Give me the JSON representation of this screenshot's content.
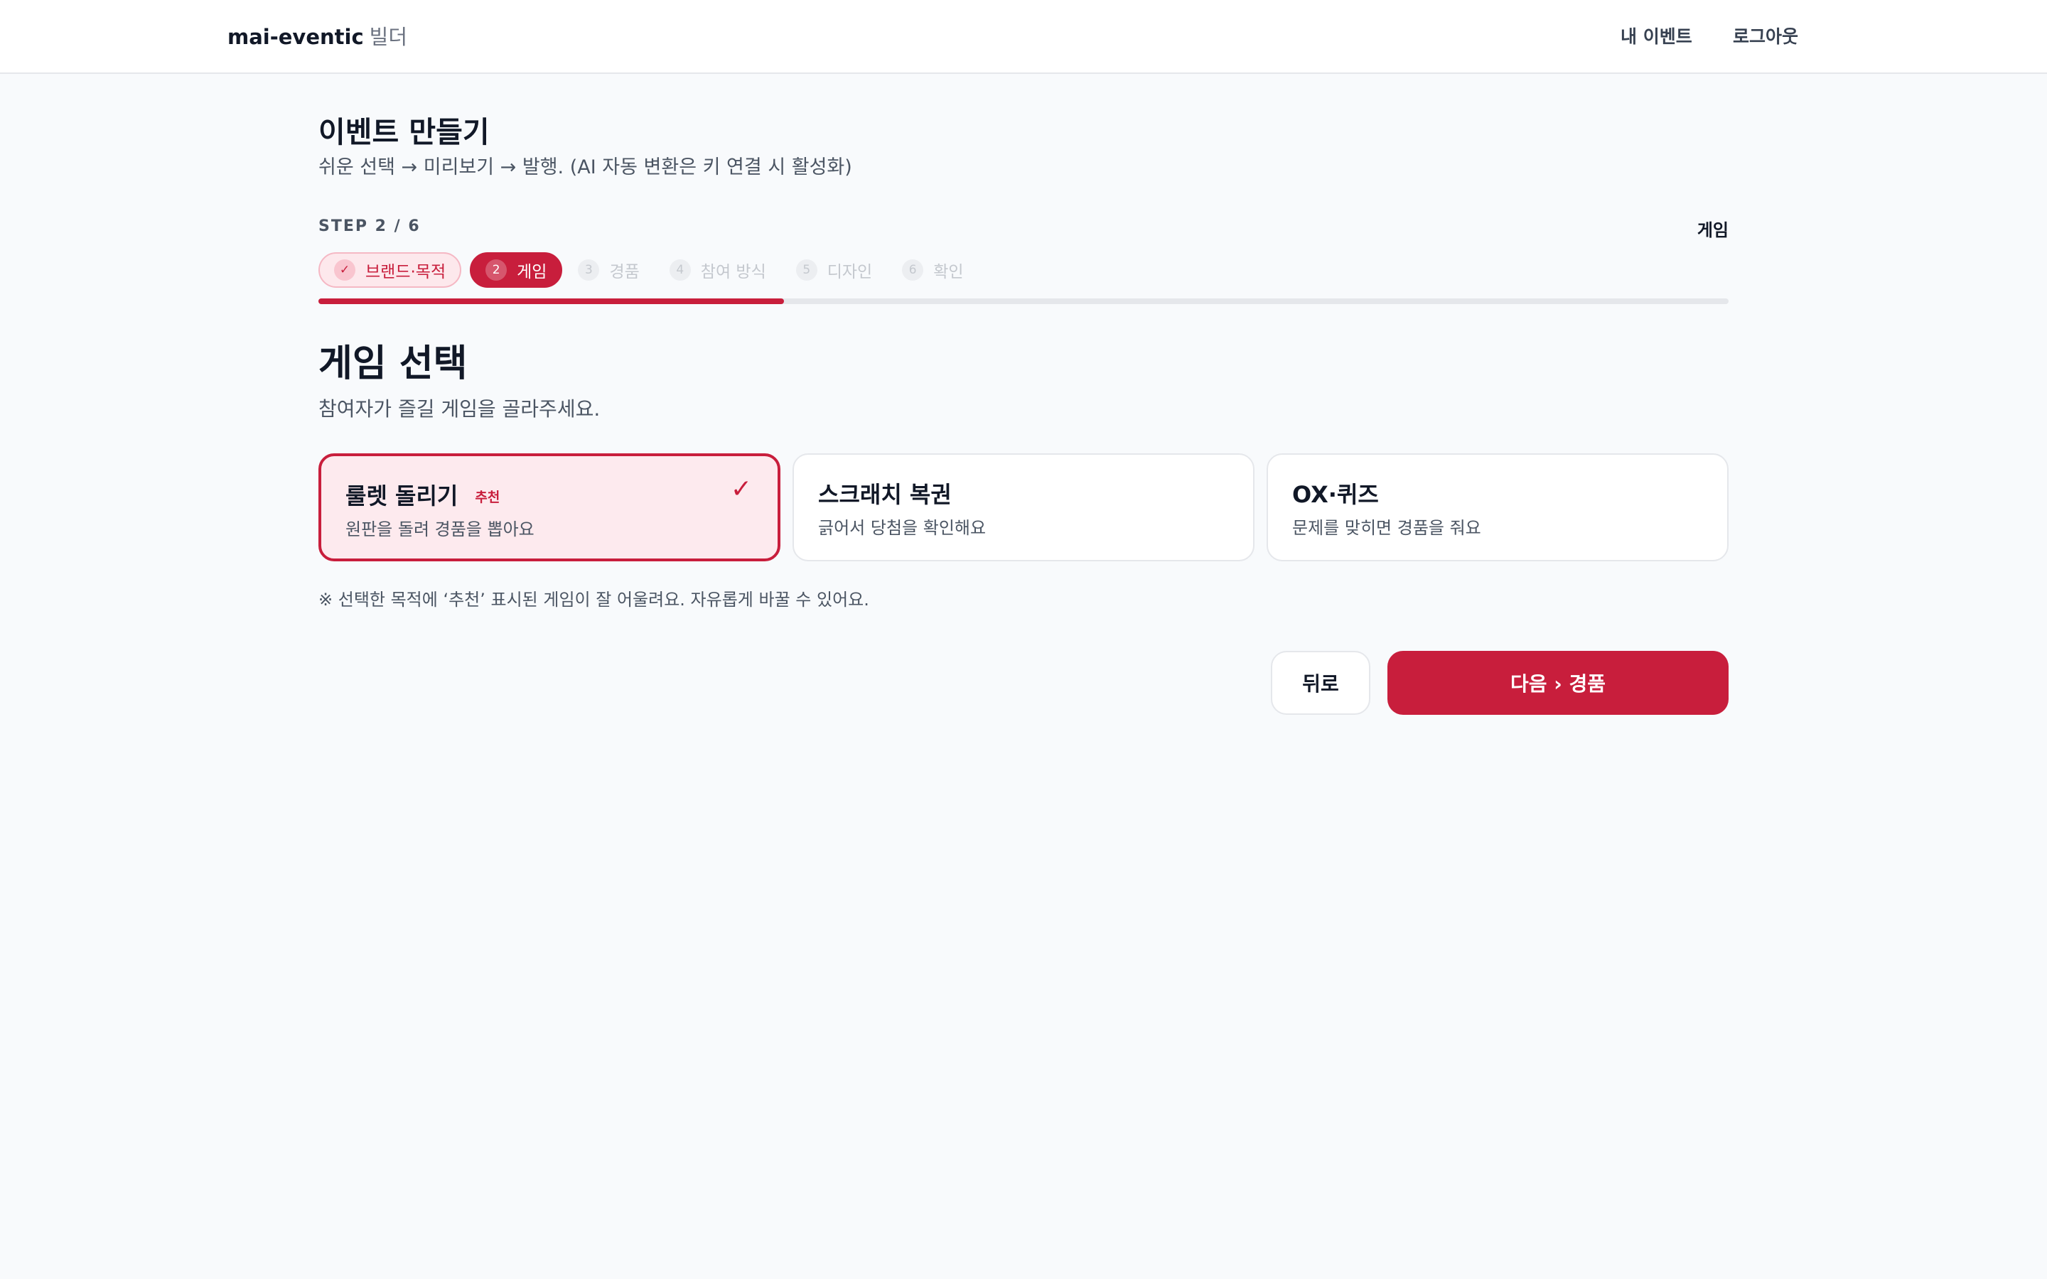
{
  "header": {
    "brand_name": "mai-eventic",
    "brand_suffix": "빌더",
    "nav_events": "내 이벤트",
    "nav_logout": "로그아웃"
  },
  "page": {
    "title": "이벤트 만들기",
    "subtitle": "쉬운 선택 → 미리보기 → 발행. (AI 자동 변환은 키 연결 시 활성화)"
  },
  "stepper": {
    "label": "STEP 2 / 6",
    "current_name": "게임",
    "progress_fraction": 0.33,
    "steps": [
      {
        "num": "✓",
        "label": "브랜드·목적",
        "state": "done"
      },
      {
        "num": "2",
        "label": "게임",
        "state": "active"
      },
      {
        "num": "3",
        "label": "경품",
        "state": "todo"
      },
      {
        "num": "4",
        "label": "참여 방식",
        "state": "todo"
      },
      {
        "num": "5",
        "label": "디자인",
        "state": "todo"
      },
      {
        "num": "6",
        "label": "확인",
        "state": "todo"
      }
    ]
  },
  "section": {
    "title": "게임 선택",
    "subtitle": "참여자가 즐길 게임을 골라주세요."
  },
  "games": [
    {
      "title": "룰렛 돌리기",
      "badge": "추천",
      "desc": "원판을 돌려 경품을 뽑아요",
      "selected": true,
      "check": "✓"
    },
    {
      "title": "스크래치 복권",
      "badge": "",
      "desc": "긁어서 당첨을 확인해요",
      "selected": false
    },
    {
      "title": "OX·퀴즈",
      "badge": "",
      "desc": "문제를 맞히면 경품을 줘요",
      "selected": false
    }
  ],
  "note": "※ 선택한 목적에 ‘추천’ 표시된 게임이 잘 어울려요. 자유롭게 바꿀 수 있어요.",
  "buttons": {
    "back": "뒤로",
    "next": "다음 › 경품"
  },
  "colors": {
    "accent": "#c81e3c",
    "accent_soft": "#fdeaee",
    "background": "#f8fafc"
  }
}
